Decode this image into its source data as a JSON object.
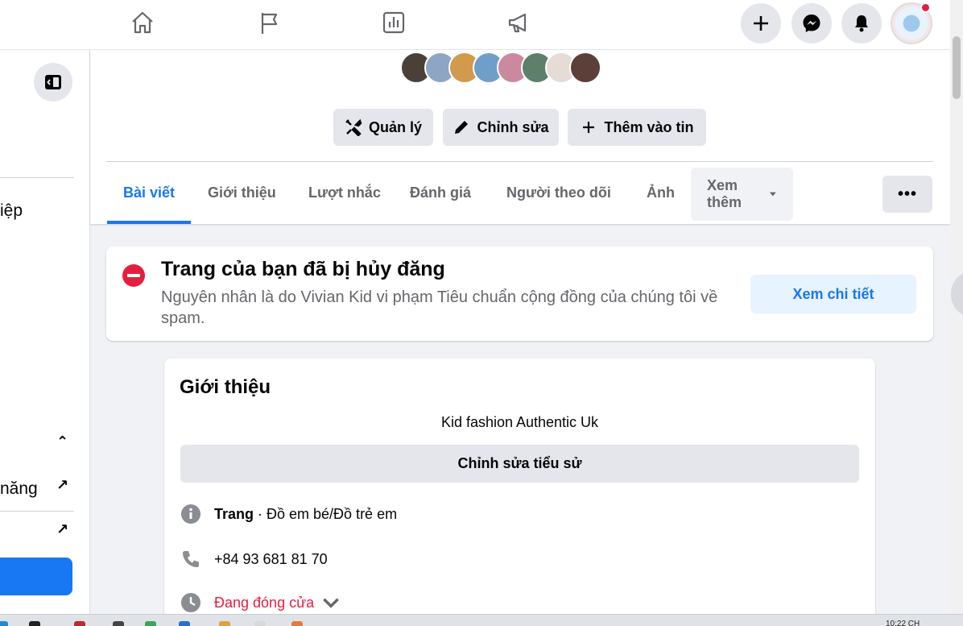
{
  "topbar": {
    "nav_icons": [
      "home-icon",
      "flag-icon",
      "chart-icon",
      "megaphone-icon"
    ],
    "actions": [
      "plus-icon",
      "messenger-icon",
      "bell-icon"
    ]
  },
  "sidebar": {
    "item_1_partial": "iệp",
    "item_2_partial": "năng"
  },
  "header": {
    "buttons": {
      "manage": "Quản lý",
      "edit": "Chỉnh sửa",
      "add_story": "Thêm vào tin"
    },
    "tabs": [
      "Bài viết",
      "Giới thiệu",
      "Lượt nhắc",
      "Đánh giá",
      "Người theo dõi",
      "Ảnh",
      "Xem thêm"
    ],
    "more_dots": "•••"
  },
  "alert": {
    "title": "Trang của bạn đã bị hủy đăng",
    "message": "Nguyên nhân là do Vivian Kid vi phạm Tiêu chuẩn cộng đồng của chúng tôi về spam.",
    "button": "Xem chi tiết"
  },
  "intro": {
    "title": "Giới thiệu",
    "bio": "Kid fashion Authentic Uk",
    "edit_bio": "Chỉnh sửa tiểu sử",
    "category_label": "Trang",
    "category_value": " · Đồ em bé/Đồ trẻ em",
    "phone": "+84 93 681 81 70",
    "hours_status": "Đang đóng cửa"
  },
  "taskbar": {
    "clock": "10:22 CH"
  },
  "colors": {
    "accent": "#1877f2",
    "danger": "#e41e3f",
    "secondary_text": "#65676b"
  }
}
